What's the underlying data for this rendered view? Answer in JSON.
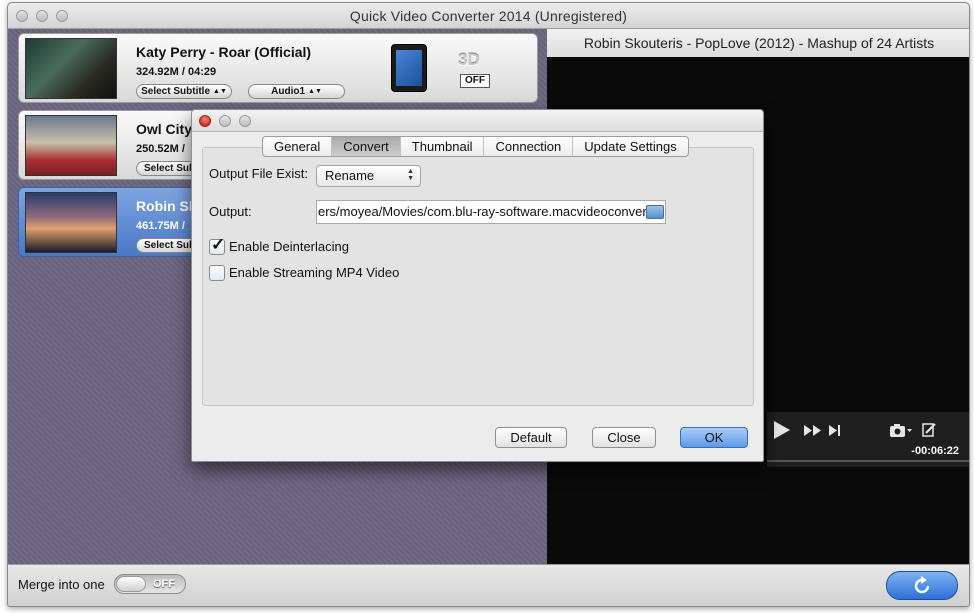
{
  "window": {
    "title": "Quick Video Converter 2014 (Unregistered)"
  },
  "videos": [
    {
      "name": "Katy Perry - Roar (Official)",
      "info": "324.92M / 04:29",
      "subtitle_label": "Select Subtitle",
      "audio_label": "Audio1",
      "selected": false
    },
    {
      "name": "Owl City",
      "info": "250.52M /",
      "subtitle_label": "Select Sub",
      "selected": false
    },
    {
      "name": "Robin Sk",
      "info": "461.75M /",
      "subtitle_label": "Select Sub",
      "selected": true
    }
  ],
  "output_device": {
    "icon": "tablet-icon",
    "three_d_label": "3D",
    "three_d_state": "OFF"
  },
  "player": {
    "now_playing": "Robin Skouteris - PopLove (2012) - Mashup of 24 Artists",
    "time_remaining": "-00:06:22"
  },
  "bottom_bar": {
    "merge_label": "Merge into one",
    "merge_state": "OFF",
    "convert_icon": "refresh-icon"
  },
  "dialog": {
    "tabs": [
      {
        "label": "General",
        "active": false
      },
      {
        "label": "Convert",
        "active": true
      },
      {
        "label": "Thumbnail",
        "active": false
      },
      {
        "label": "Connection",
        "active": false
      },
      {
        "label": "Update Settings",
        "active": false
      }
    ],
    "output_file_exist_label": "Output File Exist:",
    "output_file_exist_value": "Rename",
    "output_label": "Output:",
    "output_path": "ers/moyea/Movies/com.blu-ray-software.macvideoconvert",
    "deinterlacing_label": "Enable Deinterlacing",
    "deinterlacing_checked": true,
    "streaming_label": "Enable Streaming MP4 Video",
    "streaming_checked": false,
    "buttons": {
      "default": "Default",
      "close": "Close",
      "ok": "OK"
    }
  },
  "colors": {
    "selection_blue": "#4a78c6",
    "ok_button_blue": "#5d9ae8",
    "close_button_red": "#d8281c"
  }
}
